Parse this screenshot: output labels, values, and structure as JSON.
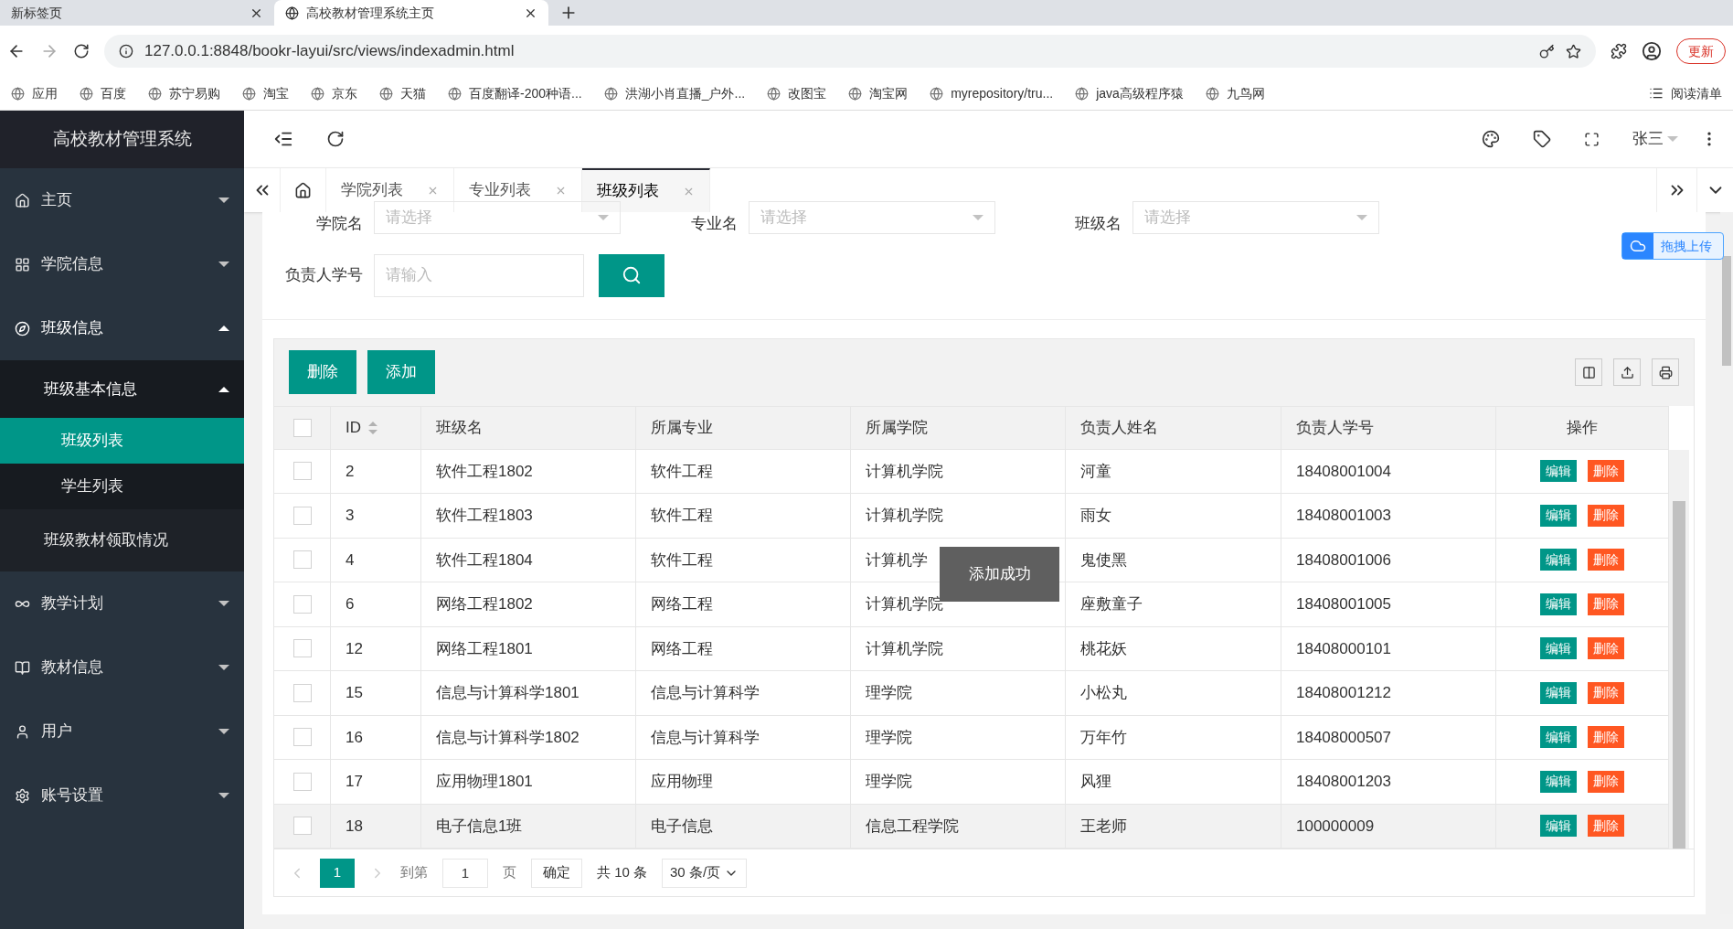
{
  "browser": {
    "tabs": [
      {
        "title": "新标签页",
        "selected": false
      },
      {
        "title": "高校教材管理系统主页",
        "selected": true
      }
    ],
    "address": "127.0.0.1:8848/bookr-layui/src/views/indexadmin.html",
    "update_button": "更新",
    "bookmarks": [
      {
        "label": "应用"
      },
      {
        "label": "百度"
      },
      {
        "label": "苏宁易购"
      },
      {
        "label": "淘宝"
      },
      {
        "label": "京东"
      },
      {
        "label": "天猫"
      },
      {
        "label": "百度翻译-200种语..."
      },
      {
        "label": "洪湖小肖直播_户外..."
      },
      {
        "label": "改图宝"
      },
      {
        "label": "淘宝网"
      },
      {
        "label": "myrepository/tru..."
      },
      {
        "label": "java高级程序猿"
      },
      {
        "label": "九鸟网"
      }
    ],
    "reading_list": "阅读清单"
  },
  "app": {
    "title": "高校教材管理系统",
    "sidebar": {
      "items": [
        {
          "label": "主页",
          "expanded": false
        },
        {
          "label": "学院信息",
          "expanded": false
        },
        {
          "label": "班级信息",
          "expanded": true,
          "children": [
            {
              "label": "班级基本信息",
              "expanded": true,
              "children": [
                {
                  "label": "班级列表",
                  "selected": true
                },
                {
                  "label": "学生列表",
                  "selected": false
                }
              ]
            },
            {
              "label": "班级教材领取情况",
              "selected": false
            }
          ]
        },
        {
          "label": "教学计划",
          "expanded": false
        },
        {
          "label": "教材信息",
          "expanded": false
        },
        {
          "label": "用户",
          "expanded": false
        },
        {
          "label": "账号设置",
          "expanded": false
        }
      ]
    },
    "header": {
      "user": "张三"
    },
    "tabs": [
      {
        "label": "学院列表",
        "selected": false
      },
      {
        "label": "专业列表",
        "selected": false
      },
      {
        "label": "班级列表",
        "selected": true
      }
    ],
    "filters": [
      {
        "kind": "select",
        "label": "学院名",
        "placeholder": "请选择"
      },
      {
        "kind": "select",
        "label": "专业名",
        "placeholder": "请选择"
      },
      {
        "kind": "select",
        "label": "班级名",
        "placeholder": "请选择"
      },
      {
        "kind": "input",
        "label": "负责人学号",
        "placeholder": "请输入"
      }
    ],
    "upload_widget": "拖拽上传",
    "toolbar": {
      "buttons": [
        "删除",
        "添加"
      ]
    },
    "table": {
      "all_checked": false,
      "columns": [
        "ID",
        "班级名",
        "所属专业",
        "所属学院",
        "负责人姓名",
        "负责人学号",
        "操作"
      ],
      "rows": [
        {
          "id": "2",
          "name": "软件工程1802",
          "major": "软件工程",
          "college": "计算机学院",
          "leader": "河童",
          "student_no": "18408001004",
          "actions": [
            "编辑",
            "删除"
          ],
          "highlighted": false
        },
        {
          "id": "3",
          "name": "软件工程1803",
          "major": "软件工程",
          "college": "计算机学院",
          "leader": "雨女",
          "student_no": "18408001003",
          "actions": [
            "编辑",
            "删除"
          ],
          "highlighted": false
        },
        {
          "id": "4",
          "name": "软件工程1804",
          "major": "软件工程",
          "college": "计算机学",
          "leader": "鬼使黑",
          "student_no": "18408001006",
          "actions": [
            "编辑",
            "删除"
          ],
          "highlighted": false
        },
        {
          "id": "6",
          "name": "网络工程1802",
          "major": "网络工程",
          "college": "计算机学院",
          "leader": "座敷童子",
          "student_no": "18408001005",
          "actions": [
            "编辑",
            "删除"
          ],
          "highlighted": false
        },
        {
          "id": "12",
          "name": "网络工程1801",
          "major": "网络工程",
          "college": "计算机学院",
          "leader": "桃花妖",
          "student_no": "18408000101",
          "actions": [
            "编辑",
            "删除"
          ],
          "highlighted": false
        },
        {
          "id": "15",
          "name": "信息与计算科学1801",
          "major": "信息与计算科学",
          "college": "理学院",
          "leader": "小松丸",
          "student_no": "18408001212",
          "actions": [
            "编辑",
            "删除"
          ],
          "highlighted": false
        },
        {
          "id": "16",
          "name": "信息与计算科学1802",
          "major": "信息与计算科学",
          "college": "理学院",
          "leader": "万年竹",
          "student_no": "18408000507",
          "actions": [
            "编辑",
            "删除"
          ],
          "highlighted": false
        },
        {
          "id": "17",
          "name": "应用物理1801",
          "major": "应用物理",
          "college": "理学院",
          "leader": "风狸",
          "student_no": "18408001203",
          "actions": [
            "编辑",
            "删除"
          ],
          "highlighted": false
        },
        {
          "id": "18",
          "name": "电子信息1班",
          "major": "电子信息",
          "college": "信息工程学院",
          "leader": "王老师",
          "student_no": "100000009",
          "actions": [
            "编辑",
            "删除"
          ],
          "highlighted": true
        }
      ]
    },
    "pagination": {
      "current_page": "1",
      "goto_label": "到第",
      "goto_value": "1",
      "page_unit": "页",
      "confirm": "确定",
      "total": "共 10 条",
      "page_size": "30 条/页"
    },
    "toast": "添加成功"
  }
}
